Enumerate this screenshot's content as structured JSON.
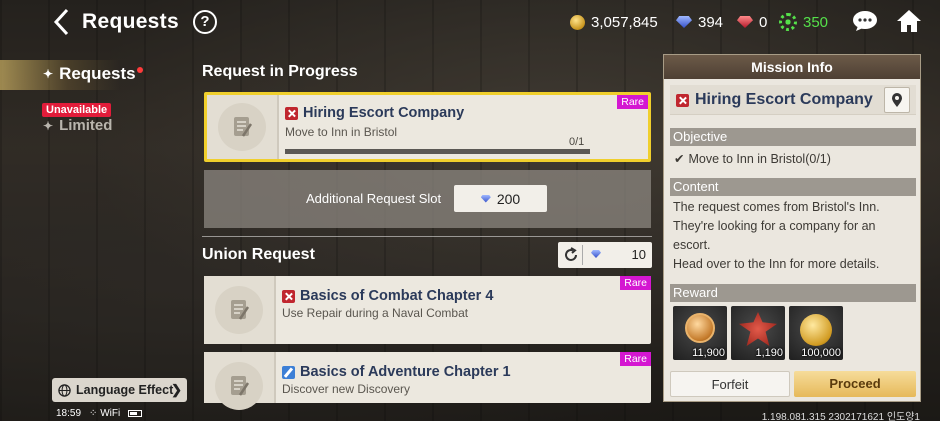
{
  "topbar": {
    "title": "Requests",
    "help": "?",
    "gold": "3,057,845",
    "blue_gems": "394",
    "red_gems": "0",
    "green_points": "350"
  },
  "left_menu": {
    "requests": "Requests",
    "unavailable": "Unavailable",
    "limited": "Limited"
  },
  "progress_section": {
    "title": "Request in Progress",
    "card": {
      "title": "Hiring Escort Company",
      "subtitle": "Move to Inn in Bristol",
      "rarity": "Rare",
      "progress": "0/1",
      "progress_fraction": 0
    },
    "slot": {
      "label": "Additional Request Slot",
      "cost": "200"
    }
  },
  "union_section": {
    "title": "Union Request",
    "refresh_cost": "10",
    "cards": [
      {
        "title": "Basics of Combat Chapter 4",
        "subtitle": "Use Repair during a Naval Combat",
        "rarity": "Rare"
      },
      {
        "title": "Basics of Adventure Chapter 1",
        "subtitle": "Discover new Discovery",
        "rarity": "Rare"
      }
    ]
  },
  "mission_info": {
    "header": "Mission Info",
    "title": "Hiring Escort Company",
    "objective_label": "Objective",
    "objective": "Move to Inn in Bristol(0/1)",
    "content_label": "Content",
    "content": "The request comes from Bristol's Inn. They're looking for a company for an escort.\nHead over to the Inn for more details.",
    "reward_label": "Reward",
    "rewards": [
      {
        "icon": "medal-icon",
        "qty": "11,900"
      },
      {
        "icon": "star-badge-icon",
        "qty": "1,190"
      },
      {
        "icon": "gold-coin-icon",
        "qty": "100,000"
      }
    ],
    "forfeit": "Forfeit",
    "proceed": "Proceed"
  },
  "footer": {
    "language_effect": "Language Effect",
    "time": "18:59",
    "wifi": "WiFi",
    "version": "1.198.081.315 2302171621 인도양1"
  },
  "colors": {
    "accent_yellow": "#f0cf2c",
    "rare_magenta": "#d417d1",
    "green_points": "#55e04a",
    "title_navy": "#2b3a5a"
  }
}
